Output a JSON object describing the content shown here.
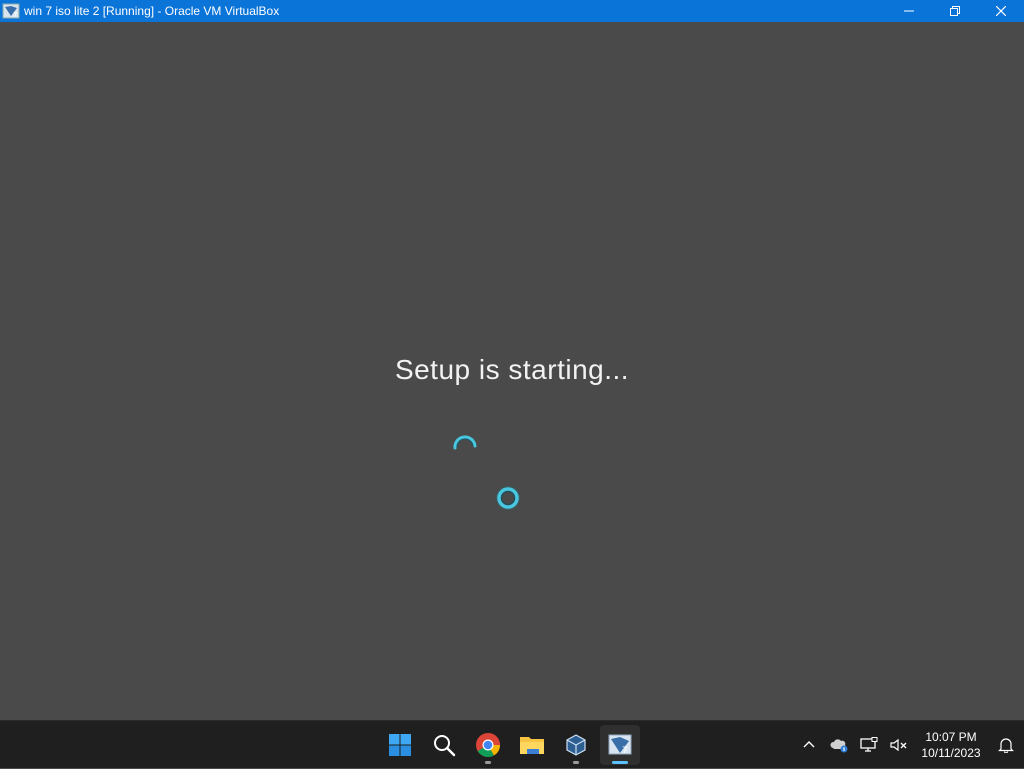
{
  "window": {
    "title": "win 7 iso lite 2 [Running] - Oracle VM VirtualBox",
    "icon": "virtualbox-vm-icon",
    "controls": [
      "minimize-icon",
      "restore-icon",
      "close-icon"
    ]
  },
  "vm": {
    "status_text": "Setup is starting...",
    "spinner_icon": "loading-spinner-icon"
  },
  "taskbar": {
    "apps": [
      {
        "name": "start-button",
        "icon": "windows-logo-icon"
      },
      {
        "name": "search-button",
        "icon": "search-icon"
      },
      {
        "name": "chrome-button",
        "icon": "chrome-icon",
        "running": true
      },
      {
        "name": "file-explorer-button",
        "icon": "folder-icon"
      },
      {
        "name": "virtualbox-button",
        "icon": "virtualbox-icon",
        "running": true
      },
      {
        "name": "vm-window-button",
        "icon": "virtualbox-vm-icon",
        "running": true,
        "active": true
      }
    ],
    "tray": [
      "chevron-up-icon",
      "onedrive-icon",
      "network-icon",
      "volume-muted-icon"
    ],
    "clock": {
      "time": "10:07 PM",
      "date": "10/11/2023"
    },
    "notification_icon": "bell-icon"
  },
  "colors": {
    "titlebar": "#0a74d8",
    "vm_background": "#4a4a4a",
    "taskbar": "#1f1f1f",
    "spinner": "#48c8e0"
  }
}
